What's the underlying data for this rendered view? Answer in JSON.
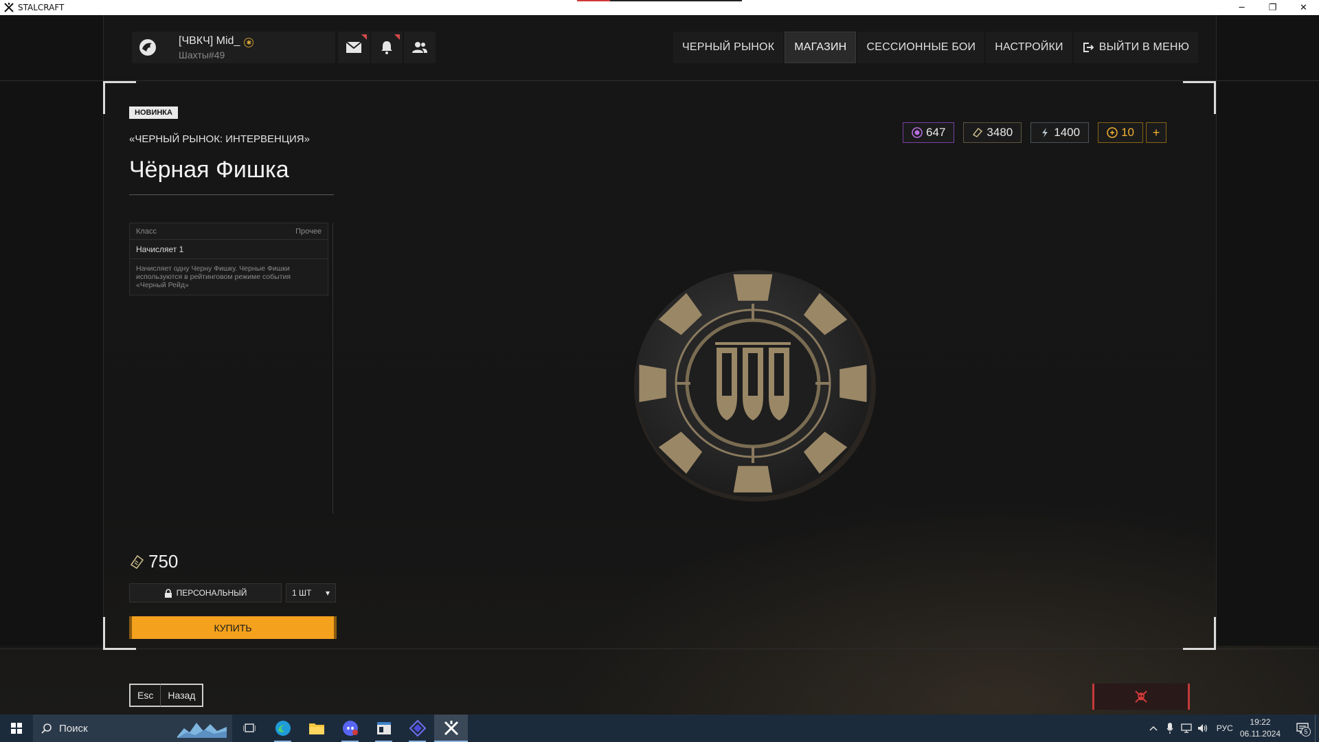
{
  "window": {
    "title": "STALCRAFT",
    "minimize_glyph": "─",
    "restore_glyph": "❐",
    "close_glyph": "✕",
    "load_progress_percent": 20
  },
  "profile": {
    "name": "[ЧВКЧ] Mid_",
    "rank_glyph": "✱",
    "server": "Шахты#49"
  },
  "nav": {
    "items": [
      {
        "label": "ЧЕРНЫЙ РЫНОК"
      },
      {
        "label": "МАГАЗИН",
        "active": true
      },
      {
        "label": "СЕССИОННЫЕ БОИ"
      },
      {
        "label": "НАСТРОЙКИ"
      },
      {
        "label": "ВЫЙТИ В МЕНЮ",
        "icon": "exit-icon"
      }
    ]
  },
  "item": {
    "badge": "НОВИНКА",
    "category": "«ЧЕРНЫЙ РЫНОК: ИНТЕРВЕНЦИЯ»",
    "title": "Чёрная Фишка",
    "class_label": "Класс",
    "class_value": "Прочее",
    "effect": "Начисляет 1",
    "description": "Начисляет одну Черну Фишку. Черные Фишки используются в рейтинговом режиме события «Черный Рейд»",
    "price": "750",
    "binding_label": "ПЕРСОНАЛЬНЫЙ",
    "quantity": "1 ШТ",
    "dropdown_glyph": "▾",
    "buy_label": "КУПИТЬ"
  },
  "currencies": [
    {
      "value": "647",
      "color": "#b66ee0",
      "icon": "premium-currency-icon"
    },
    {
      "value": "3480",
      "color": "#c9b98a",
      "icon": "ticket-currency-icon"
    },
    {
      "value": "1400",
      "color": "#b8c4cc",
      "icon": "bolt-currency-icon"
    },
    {
      "value": "10",
      "color": "#f3b232",
      "icon": "coin-currency-icon"
    }
  ],
  "currency_add_glyph": "+",
  "footer": {
    "esc_key": "Esc",
    "back_label": "Назад"
  },
  "taskbar": {
    "search_placeholder": "Поиск",
    "language": "РУС",
    "time": "19:22",
    "date": "06.11.2024",
    "notifications": "5"
  },
  "colors": {
    "accent": "#f4a11d",
    "danger": "#c43a3a",
    "chip": "#9a8766"
  }
}
